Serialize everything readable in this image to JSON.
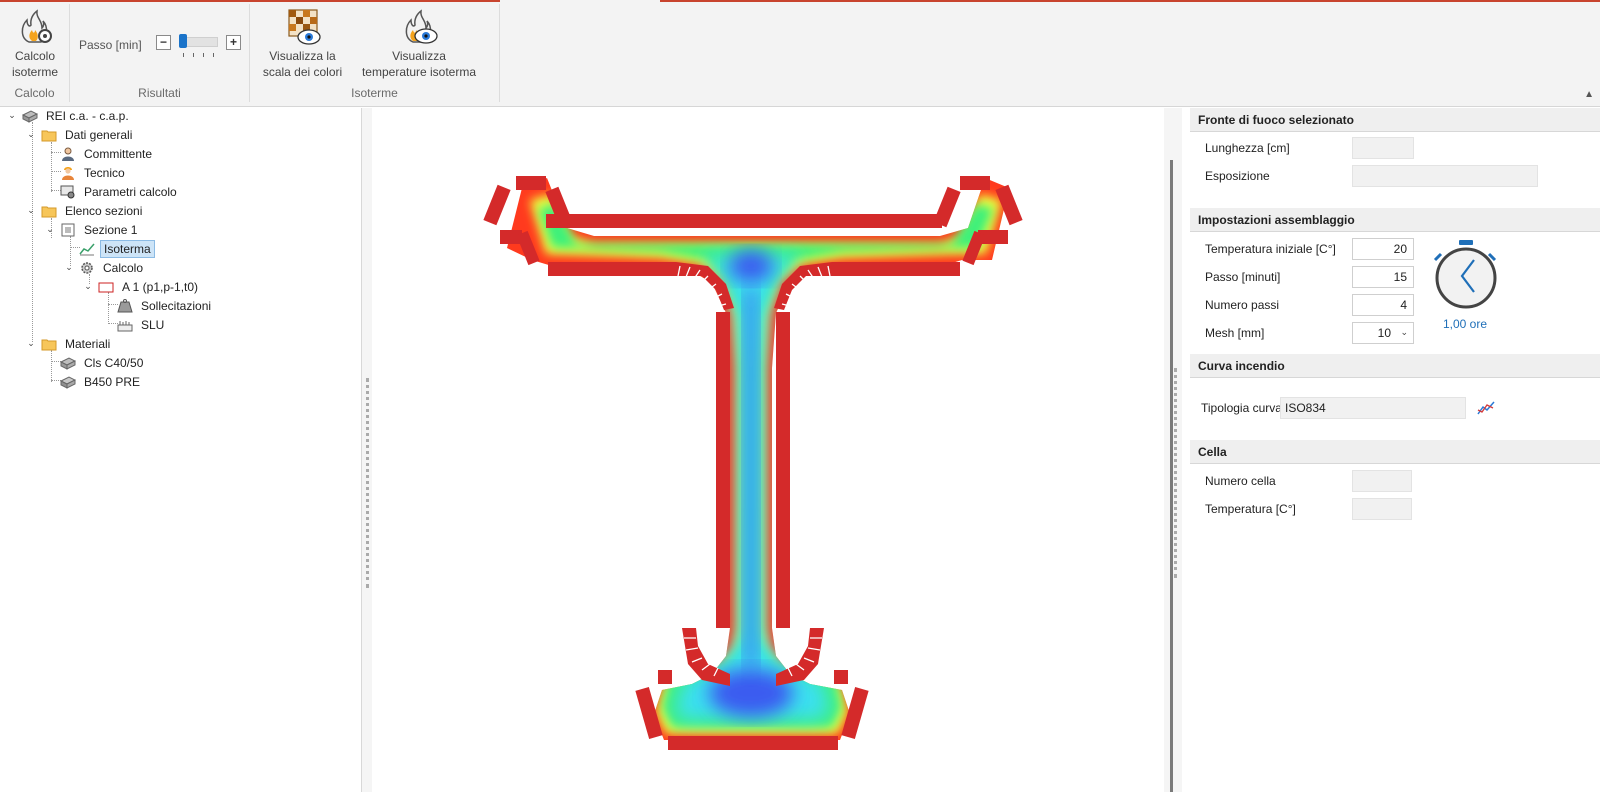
{
  "ribbon": {
    "calcolo_button": [
      "Calcolo",
      "isoterme"
    ],
    "calcolo_group": "Calcolo",
    "passo_label": "Passo [min]",
    "minus_label": "−",
    "plus_label": "+",
    "risultati_group": "Risultati",
    "scala_button": [
      "Visualizza la",
      "scala dei colori"
    ],
    "temperature_button": [
      "Visualizza",
      "temperature isoterma"
    ],
    "isoterme_group": "Isoterme",
    "collapse_icon": "chevron-up-icon"
  },
  "tree": {
    "items": [
      {
        "label": "REI c.a. - c.a.p.",
        "icon": "project-icon"
      },
      {
        "label": "Dati generali",
        "icon": "folder-icon"
      },
      {
        "label": "Committente",
        "icon": "client-icon"
      },
      {
        "label": "Tecnico",
        "icon": "engineer-icon"
      },
      {
        "label": "Parametri calcolo",
        "icon": "parameters-icon"
      },
      {
        "label": "Elenco sezioni",
        "icon": "folder-icon"
      },
      {
        "label": "Sezione 1",
        "icon": "section-icon"
      },
      {
        "label": "Isoterma",
        "icon": "isotherm-icon",
        "selected": true
      },
      {
        "label": "Calcolo",
        "icon": "gear-icon"
      },
      {
        "label": "A 1 (p1,p-1,t0)",
        "icon": "combination-icon"
      },
      {
        "label": "Sollecitazioni",
        "icon": "weight-icon"
      },
      {
        "label": "SLU",
        "icon": "ruler-icon"
      },
      {
        "label": "Materiali",
        "icon": "folder-icon"
      },
      {
        "label": "Cls C40/50",
        "icon": "concrete-icon"
      },
      {
        "label": "B450 PRE",
        "icon": "steel-icon"
      }
    ]
  },
  "canvas": {
    "colors": {
      "fire_front": "#d42a2a",
      "hot": "#ff3a1e",
      "warm": "#f4ff3a",
      "mid": "#3cf07a",
      "cool": "#3ae0f0",
      "cold": "#3a5cf0"
    }
  },
  "props": {
    "fronte": {
      "title": "Fronte di fuoco selezionato",
      "lunghezza_label": "Lunghezza [cm]",
      "esposizione_label": "Esposizione"
    },
    "impostazioni": {
      "title": "Impostazioni assemblaggio",
      "temperatura_label": "Temperatura iniziale [C°]",
      "temperatura_value": "20",
      "passo_label": "Passo [minuti]",
      "passo_value": "15",
      "numero_label": "Numero passi",
      "numero_value": "4",
      "mesh_label": "Mesh [mm]",
      "mesh_value": "10",
      "timer_value": "1,00 ore",
      "timer_fraction": 0.25
    },
    "curva": {
      "title": "Curva incendio",
      "tipologia_label": "Tipologia curva",
      "tipologia_value": "ISO834"
    },
    "cella": {
      "title": "Cella",
      "numero_label": "Numero cella",
      "temperatura_label": "Temperatura [C°]"
    }
  }
}
